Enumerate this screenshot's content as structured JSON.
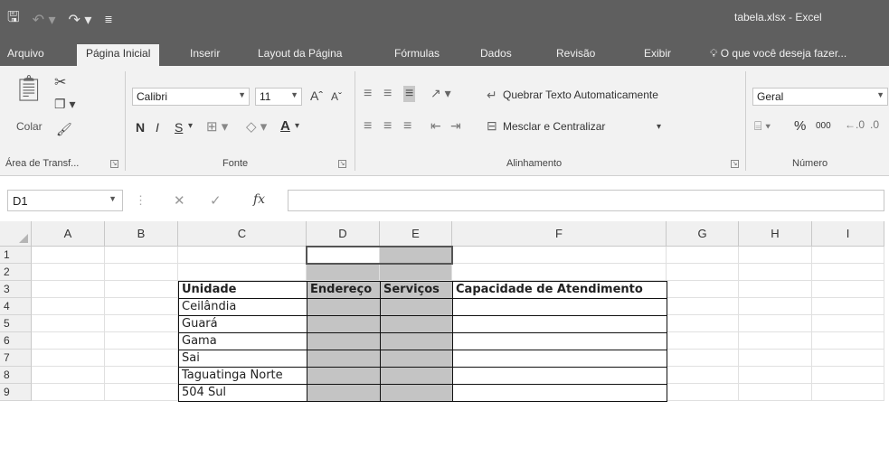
{
  "titlebar": {
    "title": "tabela.xlsx - Excel",
    "qat_icons": [
      "save-icon",
      "undo-icon",
      "redo-icon",
      "customize-icon"
    ]
  },
  "tabs": [
    "Arquivo",
    "Página Inicial",
    "Inserir",
    "Layout da Página",
    "Fórmulas",
    "Dados",
    "Revisão",
    "Exibir"
  ],
  "active_tab": "Página Inicial",
  "tell_me": "O que você deseja fazer...",
  "ribbon": {
    "clipboard": {
      "paste_label": "Colar",
      "group_label": "Área de Transf..."
    },
    "font": {
      "font_name": "Calibri",
      "font_size": "11",
      "bold": "N",
      "italic": "I",
      "underline": "S",
      "font_color": "A",
      "group_label": "Fonte"
    },
    "alignment": {
      "wrap_text": "Quebrar Texto Automaticamente",
      "merge_center": "Mesclar e Centralizar",
      "group_label": "Alinhamento"
    },
    "number": {
      "format": "Geral",
      "percent": "%",
      "thousands": "000",
      "group_label": "Número"
    }
  },
  "formula_bar": {
    "name_box": "D1",
    "fx": "fx",
    "cancel": "✕",
    "enter": "✓",
    "value": ""
  },
  "grid": {
    "columns": [
      "A",
      "B",
      "C",
      "D",
      "E",
      "F",
      "G",
      "H",
      "I"
    ],
    "rows": [
      "1",
      "2",
      "3",
      "4",
      "5",
      "6",
      "7",
      "8",
      "9"
    ],
    "selected_cell": "D1",
    "table": {
      "headers": [
        "Unidade",
        "Endereço",
        "Serviços",
        "Capacidade de Atendimento"
      ],
      "units": [
        "Ceilândia",
        "Guará",
        "Gama",
        "Sai",
        "Taguatinga Norte",
        "504 Sul"
      ]
    }
  },
  "colors": {
    "titlebar": "#5f5f5f",
    "ribbon": "#f2f2f2",
    "shaded_cell": "#c4c4c4"
  }
}
